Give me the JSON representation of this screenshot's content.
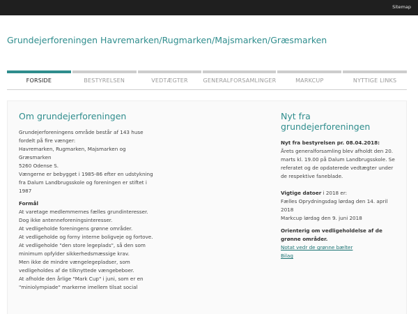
{
  "topbar": {
    "sitemap": "Sitemap"
  },
  "site_title": "Grundejerforeningen Havremarken/Rugmarken/Majsmarken/Græsmarken",
  "nav": [
    {
      "label": "FORSIDE",
      "active": true
    },
    {
      "label": "BESTYRELSEN",
      "active": false
    },
    {
      "label": "VEDTÆGTER",
      "active": false
    },
    {
      "label": "GENERALFORSAMLINGER",
      "active": false
    },
    {
      "label": "MARKCUP",
      "active": false
    },
    {
      "label": "NYTTIGE LINKS",
      "active": false
    }
  ],
  "main": {
    "heading": "Om grundejerforeningen",
    "intro": [
      "Grundejerforeningens område består af 143 huse",
      "fordelt på fire vænger:",
      "Havremarken, Rugmarken, Majsmarken og",
      "Græsmarken",
      "5260 Odense S.",
      "Vængerne er bebygget i 1985-86 efter en udstykning",
      "fra Dalum Landbrugsskole og foreningen er stiftet i",
      "1987"
    ],
    "formaal_label": "Formål",
    "formaal": [
      "At varetage medlemmernes fælles grundinteresser.",
      "Dog ikke antenneforeningsinteresser.",
      "At vedligeholde foreningens grønne områder.",
      "At vedligeholde og forny interne boligveje og fortove.",
      "At vedligeholde \"den store legeplads\", så den som",
      "minimum opfylder sikkerhedsmæssige krav.",
      "Men ikke de mindre vængelegepladser, som",
      "vedligeholdes af de tilknyttede vængebeboer.",
      "At afholde den årlige \"Mark Cup\" i juni, som er en",
      "\"miniolympiade\" markerne imellem tilsat social"
    ]
  },
  "side": {
    "heading_line1": "Nyt fra",
    "heading_line2": "grundejerforeningen",
    "news_title": "Nyt fra bestyrelsen pr. 08.04.2018:",
    "news_text": [
      "Årets generalforsamling blev afholdt den 20.",
      "marts kl. 19.00 på Dalum Landbrugsskole. Se",
      "referatet og de opdaterede vedtægter under",
      "de respektive faneblade."
    ],
    "dates_label": "Vigtige datoer",
    "dates_suffix": " i 2018 er:",
    "dates": [
      "Fælles Oprydningsdag lørdag den 14. april",
      "2018",
      "Markcup lørdag den 9. juni 2018"
    ],
    "green_title": [
      "Orienterig om vedligeholdelse af de",
      "grønne områder."
    ],
    "links": [
      "Notat vedr de grønne bælter",
      "Bilag"
    ]
  }
}
